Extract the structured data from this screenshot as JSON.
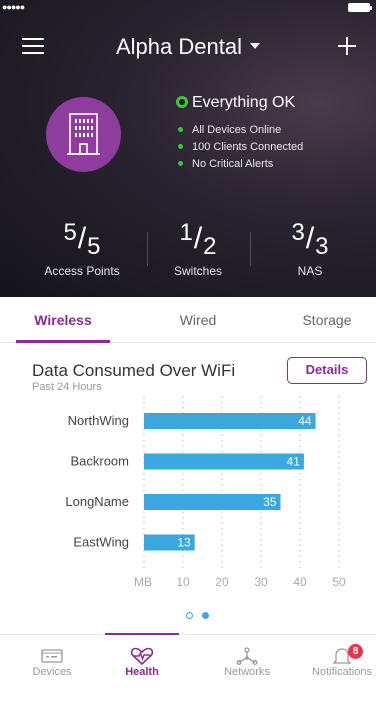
{
  "header": {
    "site_name": "Alpha Dental",
    "health_status": "Everything OK",
    "status_items": [
      "All Devices Online",
      "100 Clients Connected",
      "No Critical Alerts"
    ],
    "stats": [
      {
        "value": "5",
        "total": "5",
        "label": "Access Points"
      },
      {
        "value": "1",
        "total": "2",
        "label": "Switches"
      },
      {
        "value": "3",
        "total": "3",
        "label": "NAS"
      }
    ]
  },
  "tabs": [
    {
      "label": "Wireless",
      "active": true
    },
    {
      "label": "Wired",
      "active": false
    },
    {
      "label": "Storage",
      "active": false
    }
  ],
  "card": {
    "title": "Data Consumed Over WiFi",
    "subtitle": "Past 24 Hours",
    "details_label": "Details"
  },
  "chart_data": {
    "type": "bar",
    "orientation": "horizontal",
    "categories": [
      "NorthWing",
      "Backroom",
      "LongName",
      "EastWing"
    ],
    "values": [
      44,
      41,
      35,
      13
    ],
    "xlabel": "MB",
    "xticks": [
      10,
      20,
      30,
      40,
      50
    ],
    "xlim": [
      0,
      52
    ],
    "grid": "dotted-vertical",
    "bar_color": "#3aa8df"
  },
  "pager": {
    "count": 2,
    "active_index": 1
  },
  "bottom_nav": [
    {
      "label": "Devices",
      "icon": "devices-icon",
      "active": false
    },
    {
      "label": "Health",
      "icon": "heart-pulse-icon",
      "active": true
    },
    {
      "label": "Networks",
      "icon": "network-topology-icon",
      "active": false
    },
    {
      "label": "Notifications",
      "icon": "bell-icon",
      "active": false,
      "badge": "8"
    }
  ],
  "colors": {
    "accent": "#8b2b95",
    "ok_green": "#3ec441",
    "badge_red": "#e8344e",
    "bar_blue": "#3aa8df"
  }
}
